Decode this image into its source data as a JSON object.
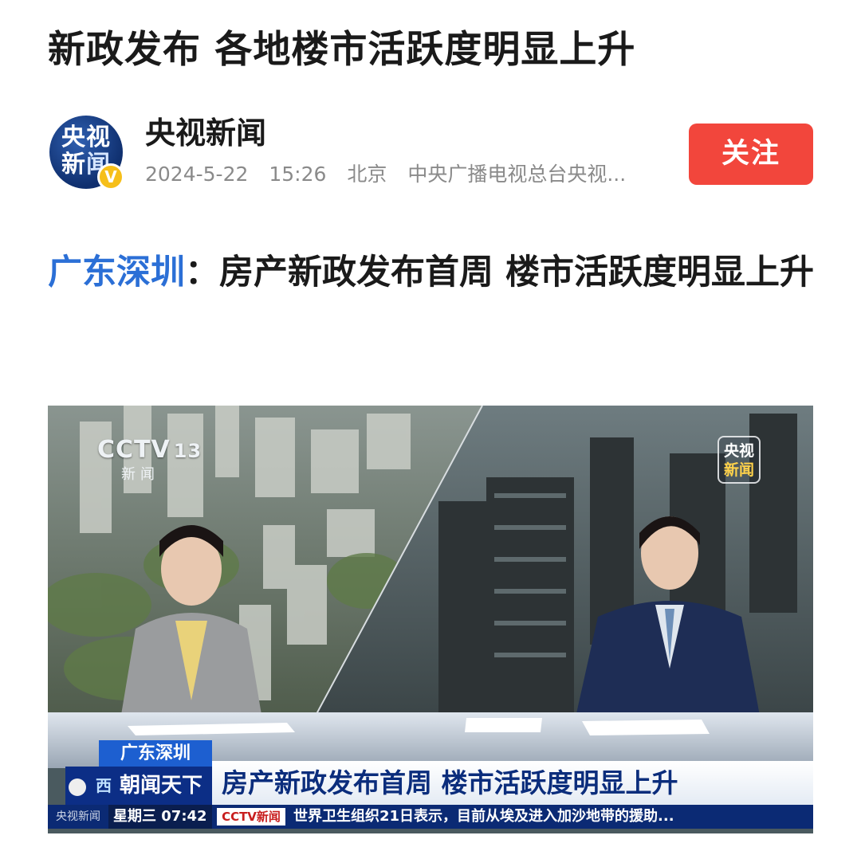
{
  "article": {
    "headline": "新政发布 各地楼市活跃度明显上升",
    "subhead_location": "广东深圳",
    "subhead_separator": "：",
    "subhead_text": "房产新政发布首周 楼市活跃度明显上升"
  },
  "author": {
    "name": "央视新闻",
    "avatar_line1": "央视",
    "avatar_line2a": "新",
    "avatar_line2b": "闻",
    "verified_mark": "V",
    "date": "2024-5-22",
    "time": "15:26",
    "location": "北京",
    "source": "中央广播电视总台央视..."
  },
  "actions": {
    "follow_label": "关注"
  },
  "video": {
    "channel_logo": "CCTV",
    "channel_number": "13",
    "channel_sub": "新闻",
    "corner_badge_line1": "央视",
    "corner_badge_line2": "新闻",
    "caption_location": "广东深圳",
    "program_prefix": "西",
    "program_name": "朝闻天下",
    "caption_main": "房产新政发布首周 楼市活跃度明显上升",
    "side_label": "央视新闻",
    "weekday_time": "星期三  07:42",
    "ticker_channel": "CCTV新闻",
    "ticker_text": "世界卫生组织21日表示，目前从埃及进入加沙地带的援助..."
  },
  "colors": {
    "follow": "#f2463c",
    "location_blue": "#2b6fd6",
    "caption_navy": "#0b2d7c"
  }
}
